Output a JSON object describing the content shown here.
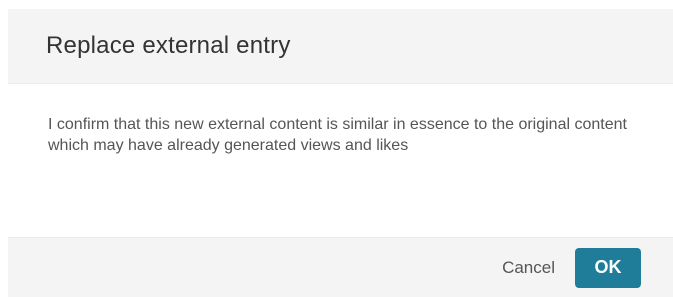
{
  "dialog": {
    "title": "Replace external entry",
    "message": "I confirm that this new external content is similar in essence to the original content which may have already generated views and likes",
    "cancel_label": "Cancel",
    "ok_label": "OK"
  },
  "colors": {
    "header_background": "#f4f4f4",
    "footer_background": "#f4f4f4",
    "ok_button": "#1f7d99",
    "text": "#555555"
  }
}
